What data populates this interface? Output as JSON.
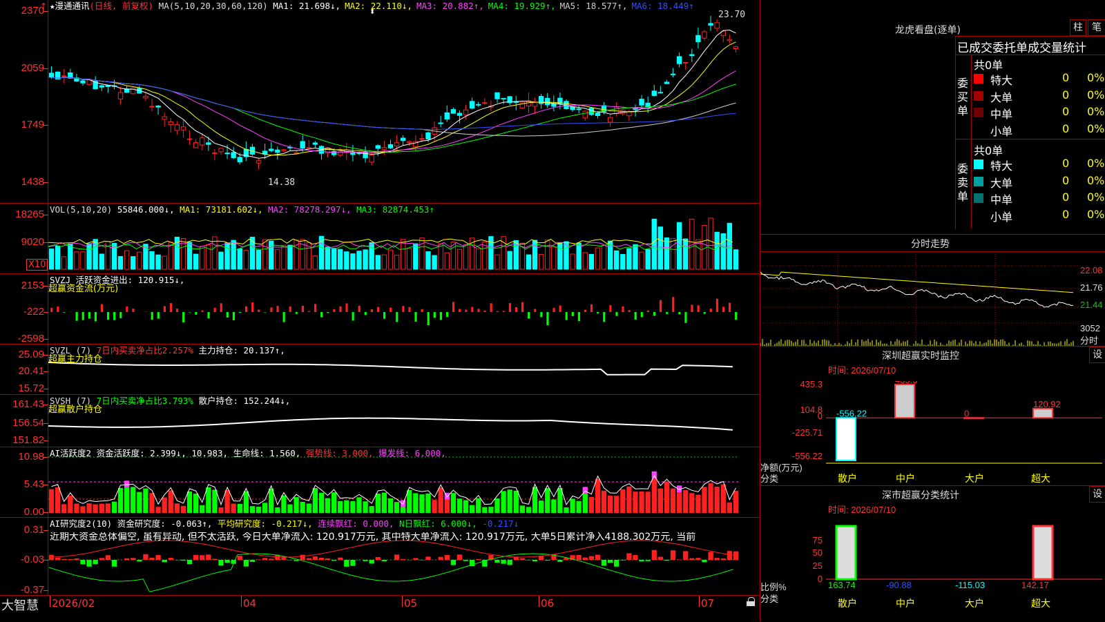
{
  "stock": {
    "name": "★漫通通讯",
    "mode": "(日线, 前复权)"
  },
  "main_chart": {
    "ma_header": "MA(5,10,20,30,60,120)",
    "ma_values": [
      {
        "label": "MA1: 21.698↓,",
        "color": "#ffffff"
      },
      {
        "label": "MA2: 22.110↓,",
        "color": "#ffff00"
      },
      {
        "label": "MA3: 20.882↑,",
        "color": "#ff40ff"
      },
      {
        "label": "MA4: 19.929↑,",
        "color": "#00ff00"
      },
      {
        "label": "MA5: 18.577↑,",
        "color": "#d0d0d0"
      },
      {
        "label": "MA6: 18.449↑",
        "color": "#3050ff"
      }
    ],
    "y_ticks": [
      "2370",
      "2059",
      "1749",
      "1438"
    ],
    "high_label": "23.70",
    "low_label": "14.38"
  },
  "vol_panel": {
    "header": "VOL(5,10,20)",
    "value": "55846.000↓,",
    "ma1": "MA1: 73181.602↓,",
    "ma2": "MA2: 78278.297↓,",
    "ma3": "MA3: 82874.453↑",
    "y_ticks": [
      "18265",
      "9020"
    ],
    "unit": "X10"
  },
  "svzj_panel": {
    "header": "SVZJ  活跃资金进出: 120.915↓,",
    "sub": "超赢资金流(万元)",
    "y_ticks": [
      "2153",
      "-222",
      "-2598"
    ]
  },
  "svzl_panel": {
    "header_a": "SVZL (7)",
    "header_b": "7日内买卖净占比2.257%",
    "header_c": "主力持仓: 20.137↑,",
    "sub": "超赢主力持仓",
    "y_ticks": [
      "25.09",
      "20.41",
      "15.72"
    ]
  },
  "svsh_panel": {
    "header_a": "SVSH (7)",
    "header_b": "7日内买卖净占比3.793%",
    "header_c": "散户持仓: 152.244↓,",
    "sub": "超赢散户持仓",
    "y_ticks": [
      "161.43",
      "156.54",
      "151.82"
    ]
  },
  "ai_active_panel": {
    "header_a": "AI活跃度2 资金活跃度: 2.399↓, 10.983, 生命线: 1.560,",
    "header_b": "强势线: 3.000,",
    "header_c": "爆发线: 6.000,",
    "y_ticks": [
      "10.98",
      "5.43",
      "0.00"
    ]
  },
  "ai_research_panel": {
    "header_a": "AI研究度2(10) 资金研究度: -0.063↑,",
    "header_b": "平均研究度: -0.217↓,",
    "header_c": "连续飘红: 0.000,",
    "header_d": "N日飘红: 6.000↓,",
    "header_e": "-0.217↓",
    "commentary": "近期大资金总体偏空, 虽有异动, 但不太活跃, 今日大单净流入: 120.917万元, 其中特大单净流入: 120.917万元, 大单5日累计净入4188.302万元, 当前",
    "y_ticks": [
      "0.31",
      "-0.03",
      "-0.37"
    ]
  },
  "x_axis": {
    "labels": [
      "2026/02",
      "04",
      "05",
      "06",
      "07"
    ],
    "app_name": "大智慧"
  },
  "longhu": {
    "title": "龙虎看盘(逐单)",
    "btn1": "柱",
    "btn2": "笔",
    "stat_title": "已成交委托单成交量统计",
    "buy": {
      "side": "委买单",
      "total": "共0单",
      "rows": [
        {
          "label": "特大",
          "count": "0",
          "pct": "0%",
          "color": "#ff0000"
        },
        {
          "label": "大单",
          "count": "0",
          "pct": "0%",
          "color": "#a00000"
        },
        {
          "label": "中单",
          "count": "0",
          "pct": "0%",
          "color": "#700000"
        },
        {
          "label": "小单",
          "count": "0",
          "pct": "0%",
          "color": ""
        }
      ]
    },
    "sell": {
      "side": "委卖单",
      "total": "共0单",
      "rows": [
        {
          "label": "特大",
          "count": "0",
          "pct": "0%",
          "color": "#00ffff"
        },
        {
          "label": "大单",
          "count": "0",
          "pct": "0%",
          "color": "#00a0a0"
        },
        {
          "label": "中单",
          "count": "0",
          "pct": "0%",
          "color": "#007070"
        },
        {
          "label": "小单",
          "count": "0",
          "pct": "0%",
          "color": ""
        }
      ]
    }
  },
  "intraday": {
    "title": "分时走势",
    "y_ticks": [
      "22.08",
      "21.76",
      "21.44"
    ],
    "vol_tick": "3052",
    "unit": "分时"
  },
  "sz_monitor": {
    "title": "深圳超赢实时监控",
    "btn": "设",
    "time": "时间: 2026/07/10",
    "y_ticks": [
      "435.3",
      "104.8",
      "0",
      "-225.71",
      "-556.22"
    ],
    "ylabel1": "净额(万元)",
    "ylabel2": "分类",
    "categories": [
      "散户",
      "中户",
      "大户",
      "超大"
    ],
    "values": [
      -556.22,
      435.3,
      0,
      120.92
    ],
    "value_labels": [
      "-556.22",
      "435.3",
      "0",
      "120.92"
    ]
  },
  "sz_class": {
    "title": "深市超赢分类统计",
    "btn": "设",
    "time": "时间: 2026/07/10",
    "y_ticks": [
      "75",
      "50",
      "25",
      "0"
    ],
    "ylabel1": "比例%",
    "ylabel2": "分类",
    "categories": [
      "散户",
      "中户",
      "大户",
      "超大"
    ],
    "values": [
      "163.74",
      "-90.88",
      "-115.03",
      "142.17"
    ]
  },
  "chart_data": [
    {
      "type": "bar",
      "title": "深圳超赢实时监控",
      "categories": [
        "散户",
        "中户",
        "大户",
        "超大"
      ],
      "values": [
        -556.22,
        435.3,
        0,
        120.92
      ],
      "ylabel": "净额(万元)",
      "ylim": [
        -556.22,
        435.3
      ]
    },
    {
      "type": "bar",
      "title": "深市超赢分类统计",
      "categories": [
        "散户",
        "中户",
        "大户",
        "超大"
      ],
      "values": [
        163.74,
        -90.88,
        -115.03,
        142.17
      ],
      "ylabel": "比例%",
      "ylim": [
        0,
        75
      ]
    }
  ]
}
